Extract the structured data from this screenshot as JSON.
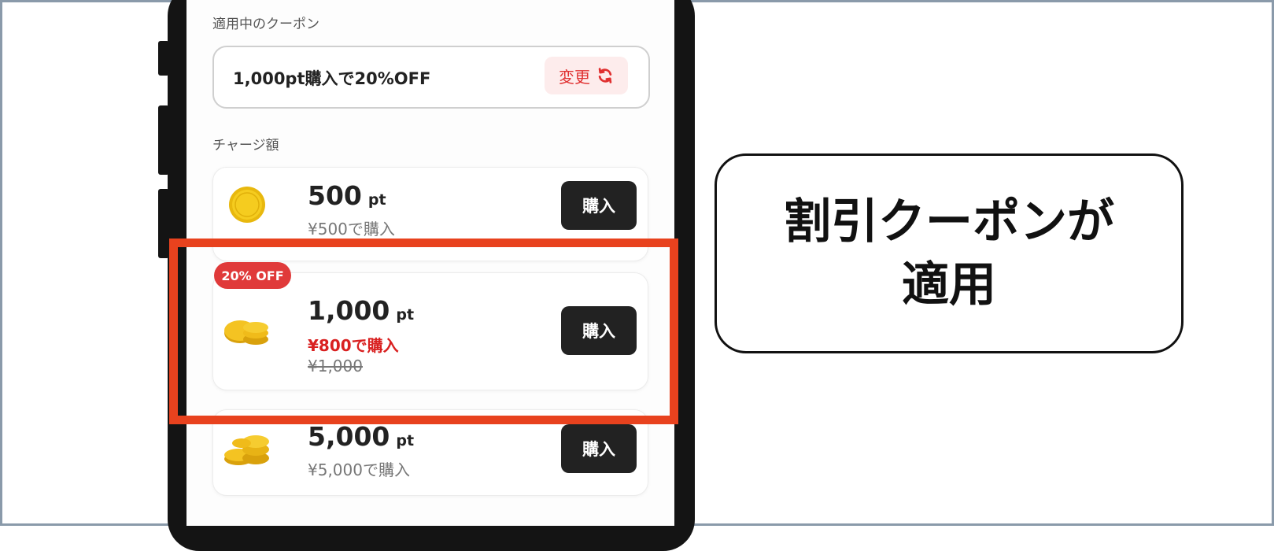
{
  "coupon": {
    "section_label": "適用中のクーポン",
    "applied_text": "1,000pt購入で20%OFF",
    "change_label": "変更"
  },
  "charge": {
    "section_label": "チャージ額",
    "buy_label": "購入",
    "options": [
      {
        "amount": "500",
        "unit": "pt",
        "price": "¥500で購入"
      },
      {
        "amount": "1,000",
        "unit": "pt",
        "badge": "20% OFF",
        "discount_price": "¥800で購入",
        "original_price": "¥1,000"
      },
      {
        "amount": "5,000",
        "unit": "pt",
        "price": "¥5,000で購入"
      }
    ]
  },
  "callout": {
    "line1": "割引クーポンが",
    "line2": "適用"
  },
  "colors": {
    "highlight": "#e8421e",
    "badge": "#e03a3a",
    "discount_text": "#d92020",
    "buy_button": "#222222"
  }
}
